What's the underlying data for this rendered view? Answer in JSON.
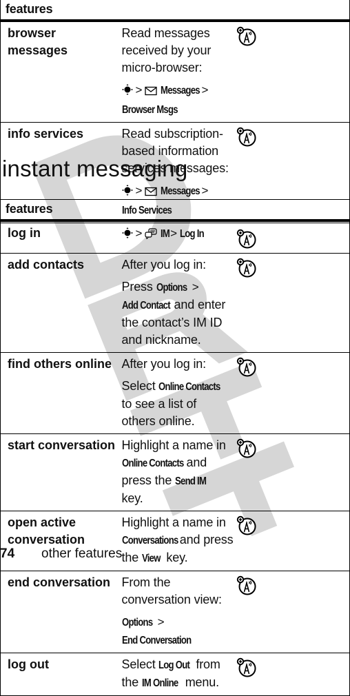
{
  "top_table": {
    "header": "features",
    "rows": [
      {
        "feature": "browser messages",
        "description": "Read messages received by your micro-browser:",
        "path": {
          "nav_icon": "nav-key-icon",
          "menu_icon": "envelope-icon",
          "steps": [
            "Messages",
            "Browser Msgs"
          ]
        },
        "badge_icon": "network-dependent-feature-icon"
      },
      {
        "feature": "info services",
        "description": "Read subscription-based information services messages:",
        "path": {
          "nav_icon": "nav-key-icon",
          "menu_icon": "envelope-icon",
          "steps": [
            "Messages",
            "Info Services"
          ]
        },
        "badge_icon": "network-dependent-feature-icon"
      }
    ]
  },
  "section_title": "instant messaging",
  "im_table": {
    "header": "features",
    "rows": [
      {
        "feature": "log in",
        "path": {
          "nav_icon": "nav-key-icon",
          "menu_icon": "im-icon",
          "steps": [
            "IM",
            "Log In"
          ]
        },
        "badge_icon": "network-dependent-feature-icon"
      },
      {
        "feature": "add contacts",
        "line1": "After you log in:",
        "line2_pre": "Press ",
        "cmd1": "Options",
        "cmd2": "Add Contact",
        "line2_post": " and enter the contact’s IM ID and nickname.",
        "badge_icon": "network-dependent-feature-icon"
      },
      {
        "feature": "find others online",
        "line1": "After you log in:",
        "line2_pre": "Select ",
        "cmd1": "Online Contacts",
        "line2_post": " to see a list of others online.",
        "badge_icon": "network-dependent-feature-icon"
      },
      {
        "feature": "start conversation",
        "pre": "Highlight a name in ",
        "cmd1": "Online Contacts",
        "mid": " and press the ",
        "cmd2": "Send IM",
        "post": " key.",
        "badge_icon": "network-dependent-feature-icon"
      },
      {
        "feature": "open active conversation",
        "pre": "Highlight a name in ",
        "cmd1": "Conversations",
        "mid": " and press the ",
        "cmd2": "View",
        "post": " key.",
        "badge_icon": "network-dependent-feature-icon"
      },
      {
        "feature": "end conversation",
        "line1": "From the conversation view:",
        "cmd1": "Options",
        "cmd2": "End Conversation",
        "badge_icon": "network-dependent-feature-icon"
      },
      {
        "feature": "log out",
        "pre": "Select ",
        "cmd1": "Log Out",
        "mid": " from the ",
        "cmd2": "IM Online",
        "post": " menu.",
        "badge_icon": "network-dependent-feature-icon"
      }
    ]
  },
  "separator": ">",
  "watermark": "DRAFT",
  "footer": {
    "page_number": "74",
    "section": "other features"
  }
}
